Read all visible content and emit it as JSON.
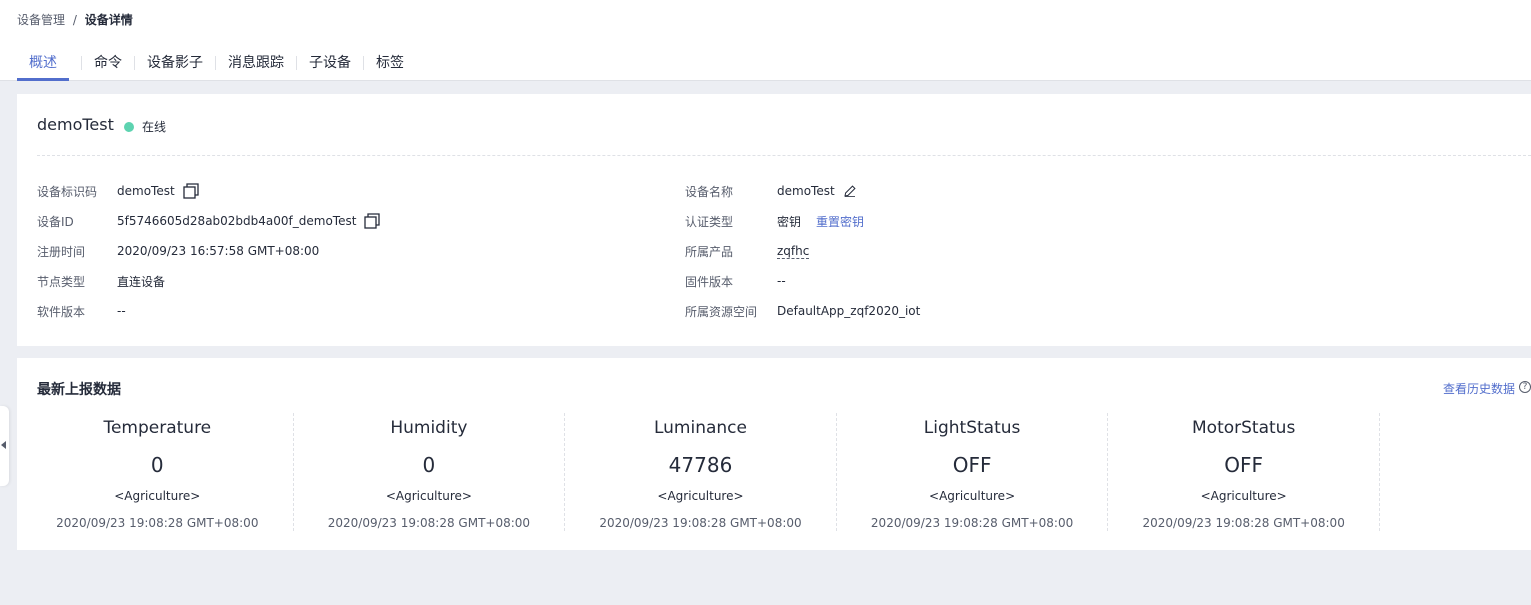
{
  "breadcrumb": {
    "parent": "设备管理",
    "separator": "/",
    "current": "设备详情"
  },
  "tabs": [
    {
      "label": "概述",
      "active": true
    },
    {
      "label": "命令"
    },
    {
      "label": "设备影子"
    },
    {
      "label": "消息跟踪"
    },
    {
      "label": "子设备"
    },
    {
      "label": "标签"
    }
  ],
  "device": {
    "name": "demoTest",
    "status": "在线",
    "status_color": "#5dd3b0"
  },
  "info_left": [
    {
      "label": "设备标识码",
      "value": "demoTest"
    },
    {
      "label": "设备ID",
      "value": "5f5746605d28ab02bdb4a00f_demoTest"
    },
    {
      "label": "注册时间",
      "value": "2020/09/23 16:57:58 GMT+08:00"
    },
    {
      "label": "节点类型",
      "value": "直连设备"
    },
    {
      "label": "软件版本",
      "value": "--"
    }
  ],
  "info_right": [
    {
      "label": "设备名称",
      "value": "demoTest"
    },
    {
      "label": "认证类型",
      "value": "密钥",
      "action": "重置密钥"
    },
    {
      "label": "所属产品",
      "value": "zqfhc"
    },
    {
      "label": "固件版本",
      "value": "--"
    },
    {
      "label": "所属资源空间",
      "value": "DefaultApp_zqf2020_iot"
    }
  ],
  "reported": {
    "title": "最新上报数据",
    "history_link": "查看历史数据",
    "help": "?",
    "metrics": [
      {
        "name": "Temperature",
        "value": "0",
        "service": "<Agriculture>",
        "time": "2020/09/23 19:08:28 GMT+08:00"
      },
      {
        "name": "Humidity",
        "value": "0",
        "service": "<Agriculture>",
        "time": "2020/09/23 19:08:28 GMT+08:00"
      },
      {
        "name": "Luminance",
        "value": "47786",
        "service": "<Agriculture>",
        "time": "2020/09/23 19:08:28 GMT+08:00"
      },
      {
        "name": "LightStatus",
        "value": "OFF",
        "service": "<Agriculture>",
        "time": "2020/09/23 19:08:28 GMT+08:00"
      },
      {
        "name": "MotorStatus",
        "value": "OFF",
        "service": "<Agriculture>",
        "time": "2020/09/23 19:08:28 GMT+08:00"
      }
    ]
  },
  "colors": {
    "accent": "#526ecc",
    "page_bg": "#eceef3",
    "text": "#252b3a",
    "muted": "#575d6c"
  }
}
